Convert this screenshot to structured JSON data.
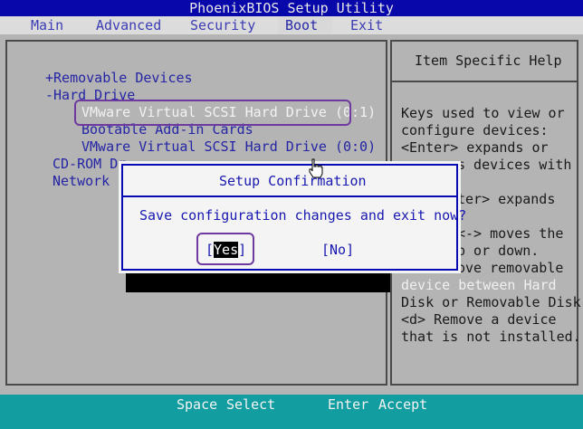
{
  "title": "PhoenixBIOS Setup Utility",
  "menu": [
    "Main",
    "Advanced",
    "Security",
    "Boot",
    "Exit"
  ],
  "boot": {
    "items": [
      "+Removable Devices",
      "-Hard Drive",
      "VMware Virtual SCSI Hard Drive (0:1)",
      "Bootable Add-in Cards",
      "VMware Virtual SCSI Hard Drive (0:0)",
      "CD-ROM Dr",
      "Network b"
    ]
  },
  "help": {
    "title": "Item Specific Help",
    "lines": [
      "Keys used to view or",
      "configure devices:",
      "<Enter> expands or",
      "s devices with",
      "ter> expands",
      "<-> moves the",
      "p or down.",
      "ove removable",
      "device between Hard",
      "Disk or Removable Disk",
      "<d> Remove a device",
      "that is not installed."
    ]
  },
  "dialog": {
    "title": "Setup Confirmation",
    "message": "Save configuration changes and exit now?",
    "yes_open": "[",
    "yes": "Yes",
    "yes_close": "]",
    "no": "[No]"
  },
  "status": {
    "key1": "Space",
    "act1": "Select",
    "key2": "Enter",
    "act2": "Accept"
  },
  "colors": {
    "title_bar": "#0707aa",
    "status_bar": "#129da0",
    "highlight": "#6e3aa0"
  },
  "icons": {
    "cursor": "hand-pointer-icon"
  }
}
